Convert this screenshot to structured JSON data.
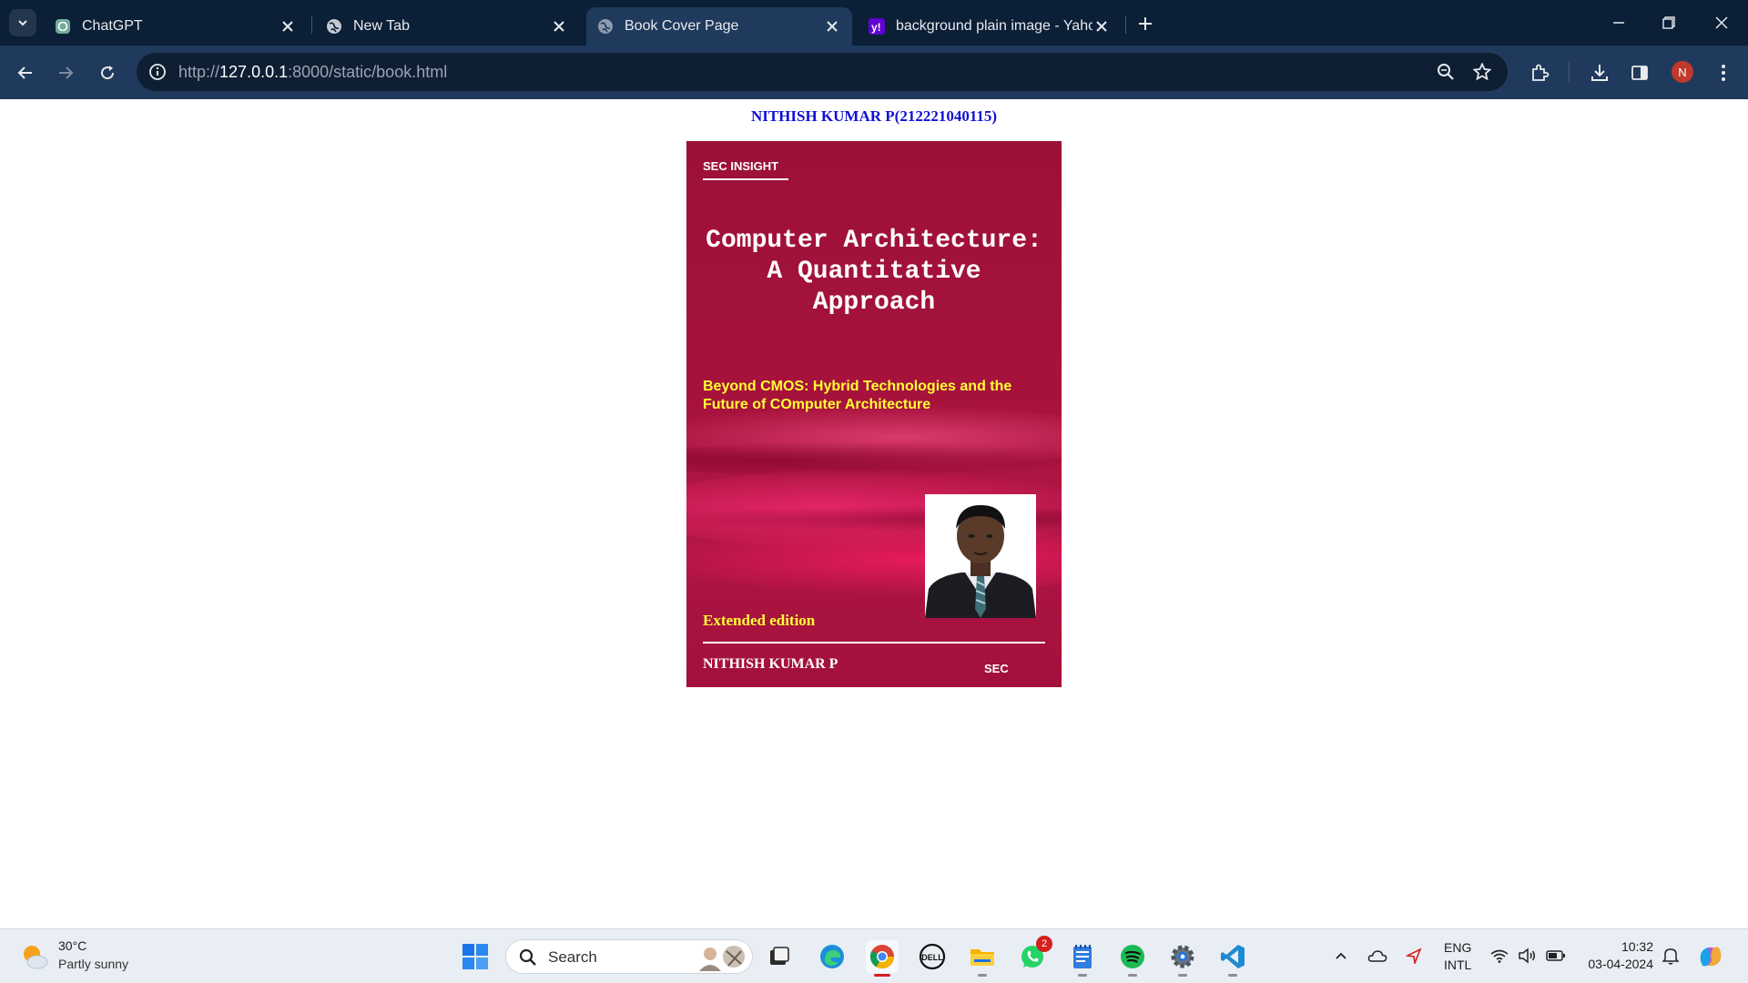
{
  "browser": {
    "tabs": [
      {
        "label": "ChatGPT",
        "icon": "chatgpt-icon"
      },
      {
        "label": "New Tab",
        "icon": "globe-icon"
      },
      {
        "label": "Book Cover Page",
        "icon": "globe-icon",
        "active": true
      },
      {
        "label": "background plain image - Yahoo",
        "icon": "yahoo-icon"
      }
    ],
    "url_scheme": "http://",
    "url_host": "127.0.0.1",
    "url_rest": ":8000/static/book.html",
    "profile_initial": "N"
  },
  "page": {
    "heading": "NITHISH KUMAR P(212221040115)",
    "cover": {
      "publisher": "SEC INSIGHT",
      "title": "Computer Architecture: A Quantitative Approach",
      "subtitle": "Beyond CMOS: Hybrid Technologies and the Future of COmputer Architecture",
      "edition": "Extended edition",
      "author": "NITHISH KUMAR P",
      "publisher_mark": "SEC"
    }
  },
  "taskbar": {
    "weather_temp": "30°C",
    "weather_desc": "Partly sunny",
    "search_placeholder": "Search",
    "whatsapp_badge": "2",
    "lang_line1": "ENG",
    "lang_line2": "INTL",
    "time": "10:32",
    "date": "03-04-2024"
  },
  "colors": {
    "tabbar": "#0b1f37",
    "toolbar": "#1f3a5c",
    "heading": "#1010d8",
    "cover": "#a6123c",
    "cover_accent_text": "#ffff33"
  }
}
